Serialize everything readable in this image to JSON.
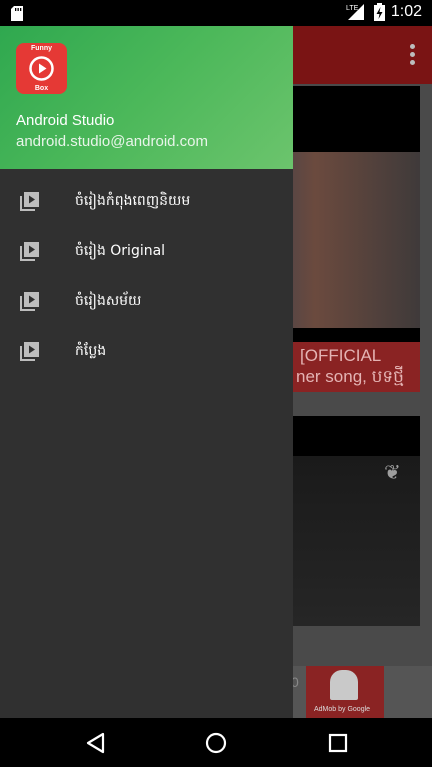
{
  "status_bar": {
    "time": "1:02",
    "network": "LTE",
    "icons": [
      "sd-card-icon",
      "signal-icon",
      "battery-charging-icon"
    ]
  },
  "background_app": {
    "card1_title": "[OFFICIAL",
    "card1_subtitle": "ner song, បទថ្មី",
    "ad_label": "AdMob by Google",
    "ad_partial": "0"
  },
  "drawer": {
    "app_logo": {
      "top_text": "Funny",
      "bottom_text": "Box",
      "color": "#e53935"
    },
    "user_name": "Android Studio",
    "user_email": "android.studio@android.com",
    "header_color": "#4cb85a",
    "items": [
      {
        "label": "ចំរៀងកំពុងពេញនិយម",
        "icon": "video-library-icon"
      },
      {
        "label": "ចំរៀង Original",
        "icon": "video-library-icon"
      },
      {
        "label": "ចំរៀងសម័យ",
        "icon": "video-library-icon"
      },
      {
        "label": "កំប្លែង",
        "icon": "video-library-icon"
      }
    ]
  },
  "nav_bar": {
    "buttons": [
      "back-icon",
      "home-icon",
      "recents-icon"
    ]
  }
}
